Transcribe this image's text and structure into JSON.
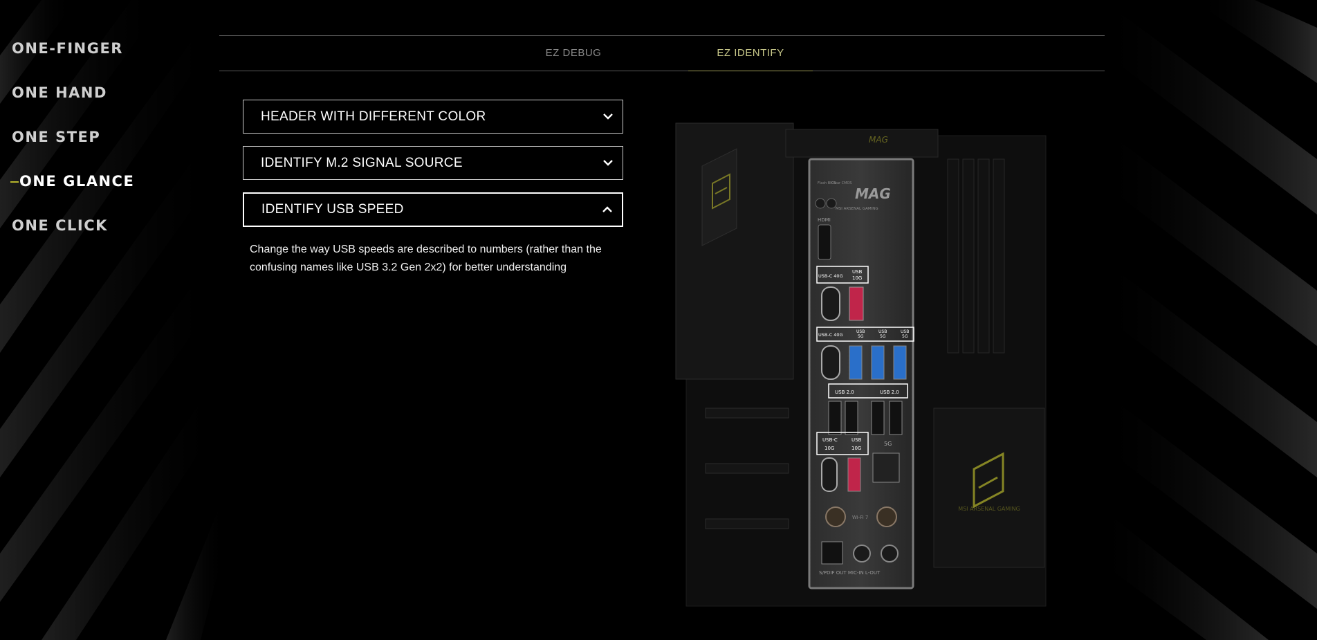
{
  "side_nav": {
    "items": [
      {
        "label": "ONE-FINGER",
        "active": false
      },
      {
        "label": "ONE HAND",
        "active": false
      },
      {
        "label": "ONE STEP",
        "active": false
      },
      {
        "label": "ONE GLANCE",
        "active": true
      },
      {
        "label": "ONE CLICK",
        "active": false
      }
    ]
  },
  "tabs": [
    {
      "label": "EZ DEBUG",
      "active": false
    },
    {
      "label": "EZ IDENTIFY",
      "active": true
    }
  ],
  "accordion": {
    "items": [
      {
        "title": "HEADER WITH DIFFERENT COLOR",
        "open": false
      },
      {
        "title": "IDENTIFY M.2 SIGNAL SOURCE",
        "open": false
      },
      {
        "title": "IDENTIFY USB SPEED",
        "open": true
      }
    ],
    "open_body": "Change the way USB speeds are described to numbers (rather than the confusing names like USB 3.2 Gen 2x2) for better understanding"
  },
  "board": {
    "brand": "MAG",
    "brand_sub": "MSI ARSENAL GAMING",
    "clear_labels": {
      "flash": "Flash\nBIOS\nButton",
      "clear": "Clear\nCMOS\nButton"
    },
    "hdmi": "HDMI",
    "usb_labels": {
      "c40_a": "USB-C 40G",
      "usb10_a": "USB\n10G",
      "c40_b": "USB-C 40G",
      "usb5_1": "USB\n5G",
      "usb5_2": "USB\n5G",
      "usb5_3": "USB\n5G",
      "usb20_a": "USB 2.0",
      "usb20_b": "USB 2.0",
      "c10": "USB-C\n10G",
      "usb10_b": "USB\n10G",
      "lan": "5G"
    },
    "wifi": "Wi-Fi 7",
    "audio": "S/PDIF OUT  MIC-IN  L-OUT",
    "deco_text": "MSI ARSENAL GAMING",
    "colors": {
      "accent": "#b6b52c",
      "usb_blue": "#2a6fc9",
      "usb_red": "#c0254a"
    }
  }
}
